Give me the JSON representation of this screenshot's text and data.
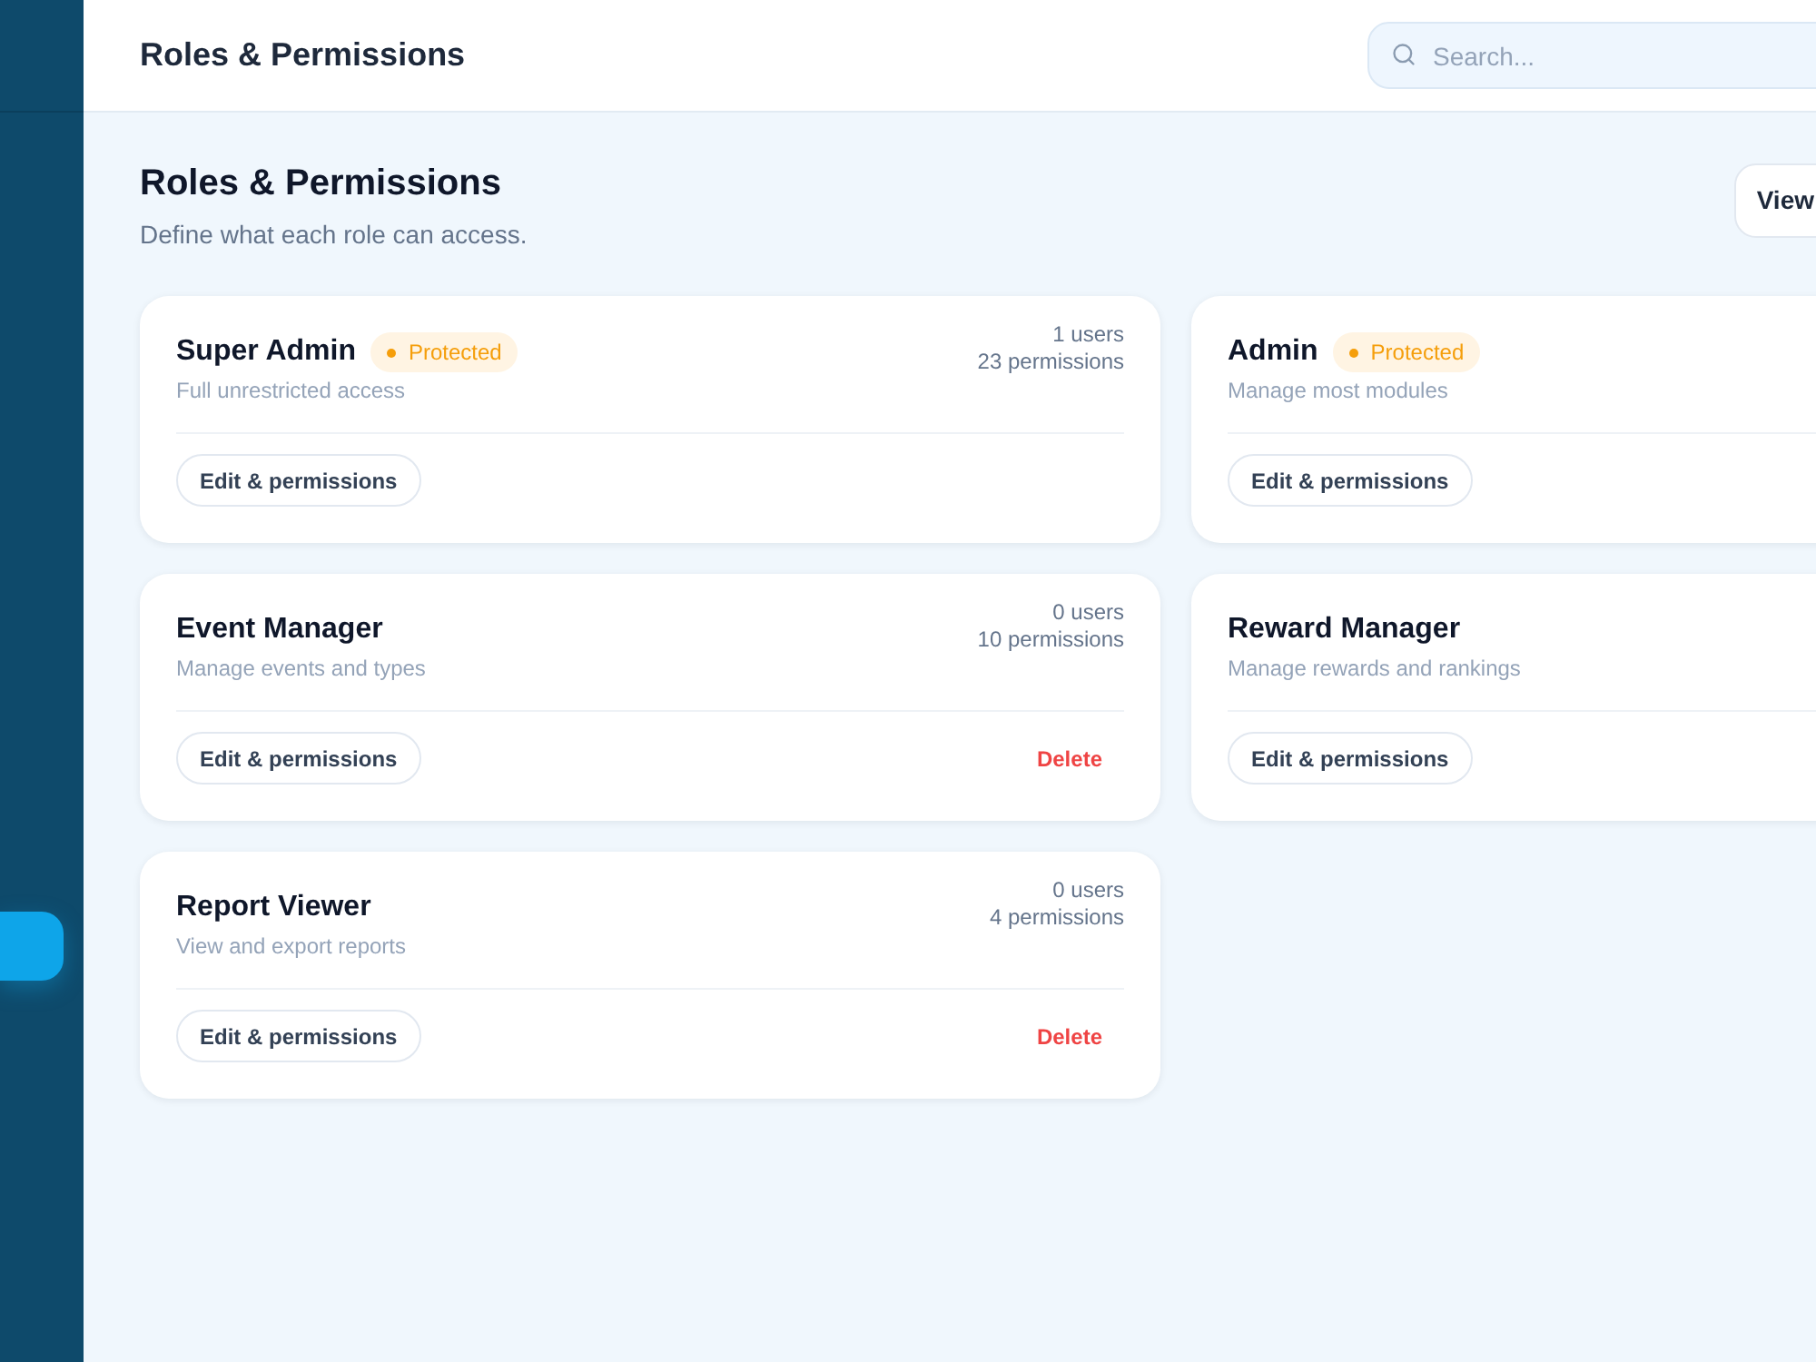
{
  "sidebar": {
    "items": [
      {
        "selected": true
      }
    ]
  },
  "header": {
    "title": "Roles & Permissions",
    "search": {
      "placeholder": "Search..."
    }
  },
  "page": {
    "title": "Roles & Permissions",
    "subtitle": "Define what each role can access.",
    "action_button": "View"
  },
  "roles": [
    {
      "name": "Super Admin",
      "badge": "Protected",
      "description": "Full unrestricted access",
      "users": "1 users",
      "permissions": "23 permissions",
      "edit_button": "Edit & permissions"
    },
    {
      "name": "Admin",
      "badge": "Protected",
      "description": "Manage most modules",
      "edit_button": "Edit & permissions"
    },
    {
      "name": "Event Manager",
      "description": "Manage events and types",
      "users": "0 users",
      "permissions": "10 permissions",
      "edit_button": "Edit & permissions",
      "delete_button": "Delete"
    },
    {
      "name": "Reward Manager",
      "description": "Manage rewards and rankings",
      "edit_button": "Edit & permissions"
    },
    {
      "name": "Report Viewer",
      "description": "View and export reports",
      "users": "0 users",
      "permissions": "4 permissions",
      "edit_button": "Edit & permissions",
      "delete_button": "Delete"
    }
  ]
}
